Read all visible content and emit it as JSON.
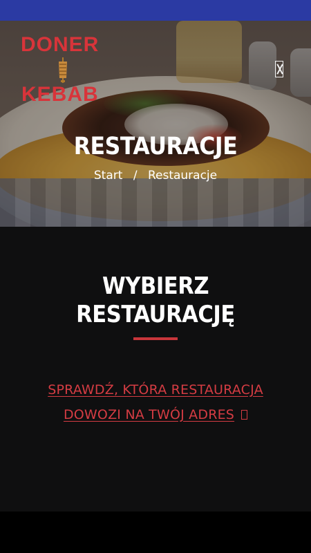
{
  "status_bar": {
    "color": "#2b3aa3"
  },
  "logo": {
    "line1": "DONER",
    "line2": "KEBAB",
    "color": "#d8343a"
  },
  "header": {
    "menu_icon": "menu-icon"
  },
  "hero": {
    "title": "RESTAURACJE",
    "breadcrumb": {
      "items": [
        "Start",
        "Restauracje"
      ],
      "separator": "/"
    }
  },
  "main": {
    "heading_line1": "WYBIERZ",
    "heading_line2": "RESTAURACJĘ",
    "cta_line1": "SPRAWDŹ, KTÓRA RESTAURACJA",
    "cta_line2": "DOWOZI NA TWÓJ ADRES",
    "cta_icon": "external-link-icon",
    "accent_color": "#c9363b"
  }
}
